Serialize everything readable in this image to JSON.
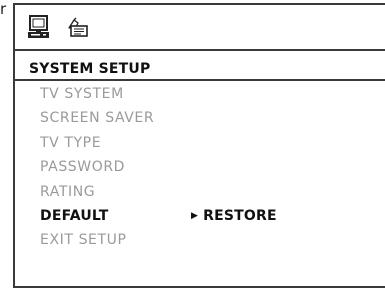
{
  "edge_glyph": "r",
  "icon_bar": {
    "icons": [
      "system-setup-icon",
      "preferences-icon"
    ]
  },
  "menu": {
    "title": "SYSTEM SETUP",
    "items": [
      {
        "label": "TV SYSTEM",
        "state": "disabled"
      },
      {
        "label": "SCREEN SAVER",
        "state": "disabled"
      },
      {
        "label": "TV TYPE",
        "state": "disabled"
      },
      {
        "label": "PASSWORD",
        "state": "disabled"
      },
      {
        "label": "RATING",
        "state": "disabled"
      },
      {
        "label": "DEFAULT",
        "state": "selected"
      },
      {
        "label": "EXIT SETUP",
        "state": "disabled"
      }
    ]
  },
  "submenu": {
    "arrow": "▶",
    "option": "RESTORE"
  },
  "colors": {
    "border": "#3a3a3a",
    "active_text": "#111111",
    "inactive_text": "#9a9a9a",
    "background": "#ffffff"
  }
}
